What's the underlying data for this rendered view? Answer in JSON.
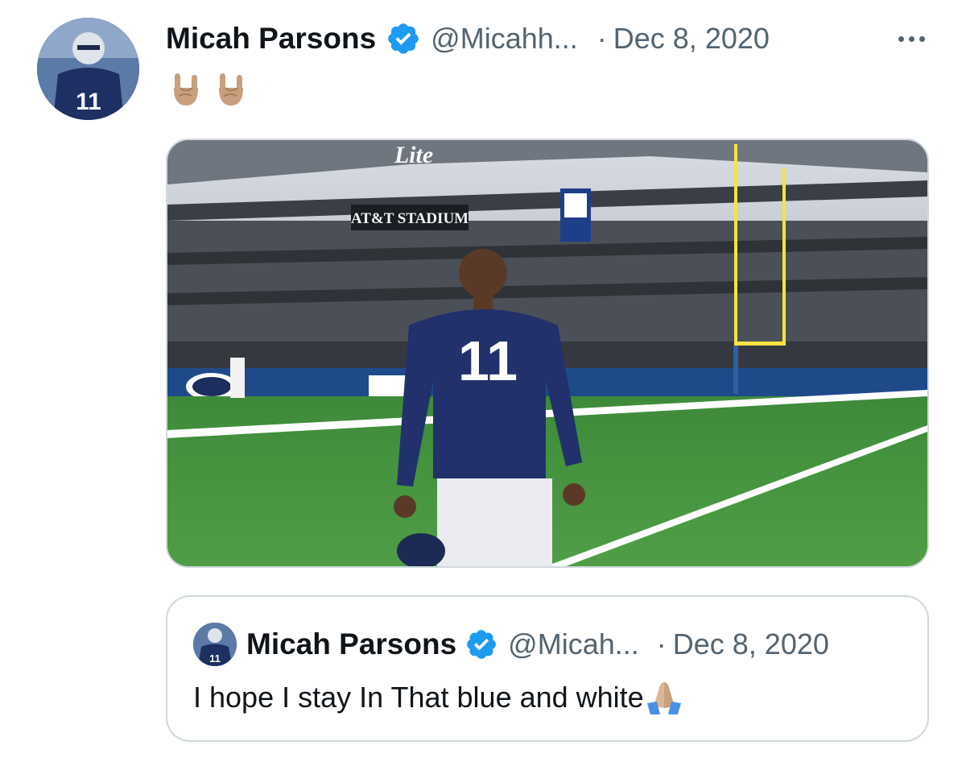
{
  "tweet": {
    "author_name": "Micah Parsons",
    "handle": "@Micahh...",
    "separator": "·",
    "date": "Dec 8, 2020",
    "emojis": [
      "rock-on-hand-emoji",
      "rock-on-hand-emoji"
    ],
    "media": {
      "stadium_sign": "AT&T STADIUM",
      "sponsor_sign": "Lite",
      "jersey_number": "11"
    }
  },
  "quoted_tweet": {
    "author_name": "Micah Parsons",
    "handle": "@Micah...",
    "separator": "·",
    "date": "Dec 8, 2020",
    "text": "I hope I stay In That blue and white",
    "trailing_emoji": "praying-hands-emoji"
  },
  "colors": {
    "verified_blue": "#1d9bf0",
    "secondary_text": "#536471",
    "border": "#cfd9de",
    "emoji_skin": "#c8a07c"
  }
}
